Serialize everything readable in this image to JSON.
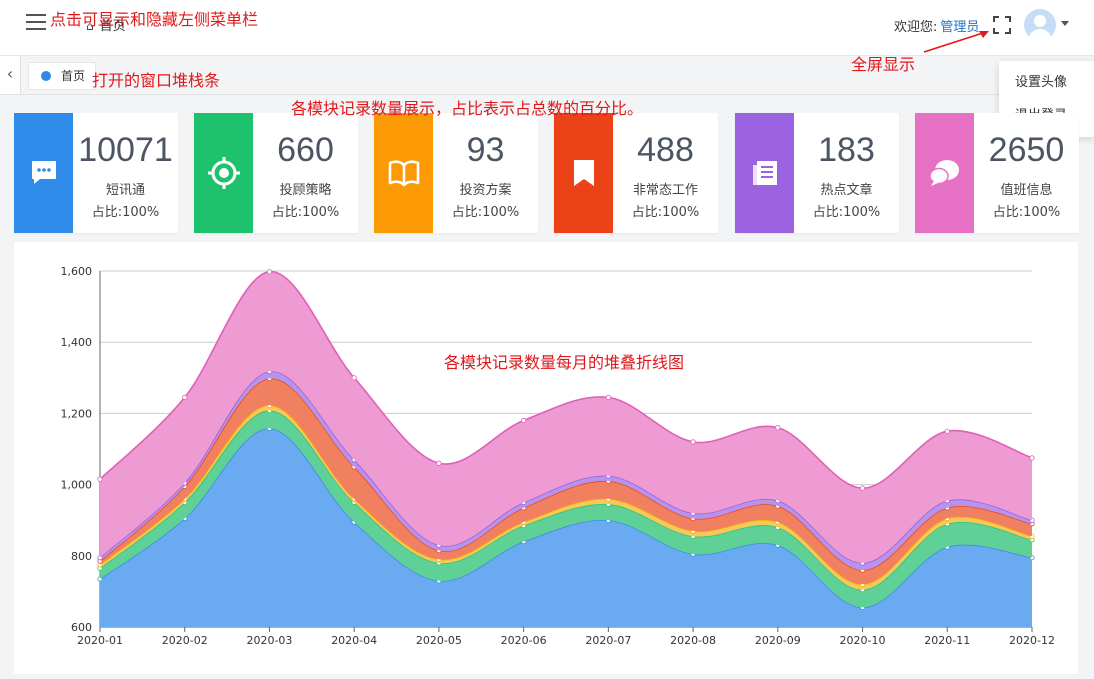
{
  "header": {
    "breadcrumb_home": "首页",
    "welcome": "欢迎您:",
    "user_name": "管理员"
  },
  "tabs": [
    {
      "label": "首页"
    }
  ],
  "user_menu": [
    {
      "label": "设置头像"
    },
    {
      "label": "退出登录"
    }
  ],
  "annotations": {
    "menu_toggle": "点击可显示和隐藏左侧菜单栏",
    "tabs": "打开的窗口堆栈条",
    "fullscreen": "全屏显示",
    "cards": "各模块记录数量展示，占比表示占总数的百分比。",
    "chart": "各模块记录数量每月的堆叠折线图"
  },
  "cards": [
    {
      "value": "10071",
      "label": "短讯通",
      "ratio": "占比:100%",
      "color": "#2f8ceb",
      "icon": "chat-bubble-icon"
    },
    {
      "value": "660",
      "label": "投顾策略",
      "ratio": "占比:100%",
      "color": "#1ec16c",
      "icon": "target-icon"
    },
    {
      "value": "93",
      "label": "投资方案",
      "ratio": "占比:100%",
      "color": "#fb9a05",
      "icon": "book-icon"
    },
    {
      "value": "488",
      "label": "非常态工作",
      "ratio": "占比:100%",
      "color": "#eb4217",
      "icon": "bookmark-icon"
    },
    {
      "value": "183",
      "label": "热点文章",
      "ratio": "占比:100%",
      "color": "#9b63e0",
      "icon": "article-icon"
    },
    {
      "value": "2650",
      "label": "值班信息",
      "ratio": "占比:100%",
      "color": "#e570c4",
      "icon": "chat-bubbles-icon"
    }
  ],
  "chart_data": {
    "type": "area",
    "stacked": true,
    "smooth": true,
    "title": "",
    "xlabel": "",
    "ylabel": "",
    "x": [
      "2020-01",
      "2020-02",
      "2020-03",
      "2020-04",
      "2020-05",
      "2020-06",
      "2020-07",
      "2020-08",
      "2020-09",
      "2020-10",
      "2020-11",
      "2020-12"
    ],
    "ylim": [
      600,
      1600
    ],
    "yticks": [
      600,
      800,
      1000,
      1200,
      1400,
      1600
    ],
    "y_tick_labels": [
      "600",
      "800",
      "1,000",
      "1,200",
      "1,400",
      "1,600"
    ],
    "grid": true,
    "legend": "none",
    "series": [
      {
        "color": "#6aaaf1",
        "line_color": "#3a8ee6",
        "values": [
          735,
          905,
          1158,
          895,
          730,
          840,
          900,
          805,
          830,
          655,
          825,
          795
        ]
      },
      {
        "color": "#5fd196",
        "line_color": "#2ec27e",
        "values": [
          30,
          45,
          50,
          55,
          50,
          45,
          45,
          50,
          50,
          50,
          65,
          50
        ]
      },
      {
        "color": "#f5c85a",
        "line_color": "#f5b200",
        "values": [
          10,
          10,
          15,
          10,
          10,
          10,
          15,
          15,
          15,
          15,
          15,
          10
        ]
      },
      {
        "color": "#f0805f",
        "line_color": "#ee4b23",
        "values": [
          10,
          35,
          75,
          90,
          25,
          40,
          50,
          35,
          45,
          40,
          30,
          35
        ]
      },
      {
        "color": "#b793ec",
        "line_color": "#9b63e0",
        "values": [
          10,
          10,
          20,
          20,
          15,
          15,
          15,
          15,
          15,
          20,
          20,
          10
        ]
      },
      {
        "color": "#ed9bd2",
        "line_color": "#e060b8",
        "values": [
          220,
          240,
          280,
          230,
          230,
          230,
          220,
          200,
          205,
          210,
          195,
          175
        ]
      }
    ]
  }
}
